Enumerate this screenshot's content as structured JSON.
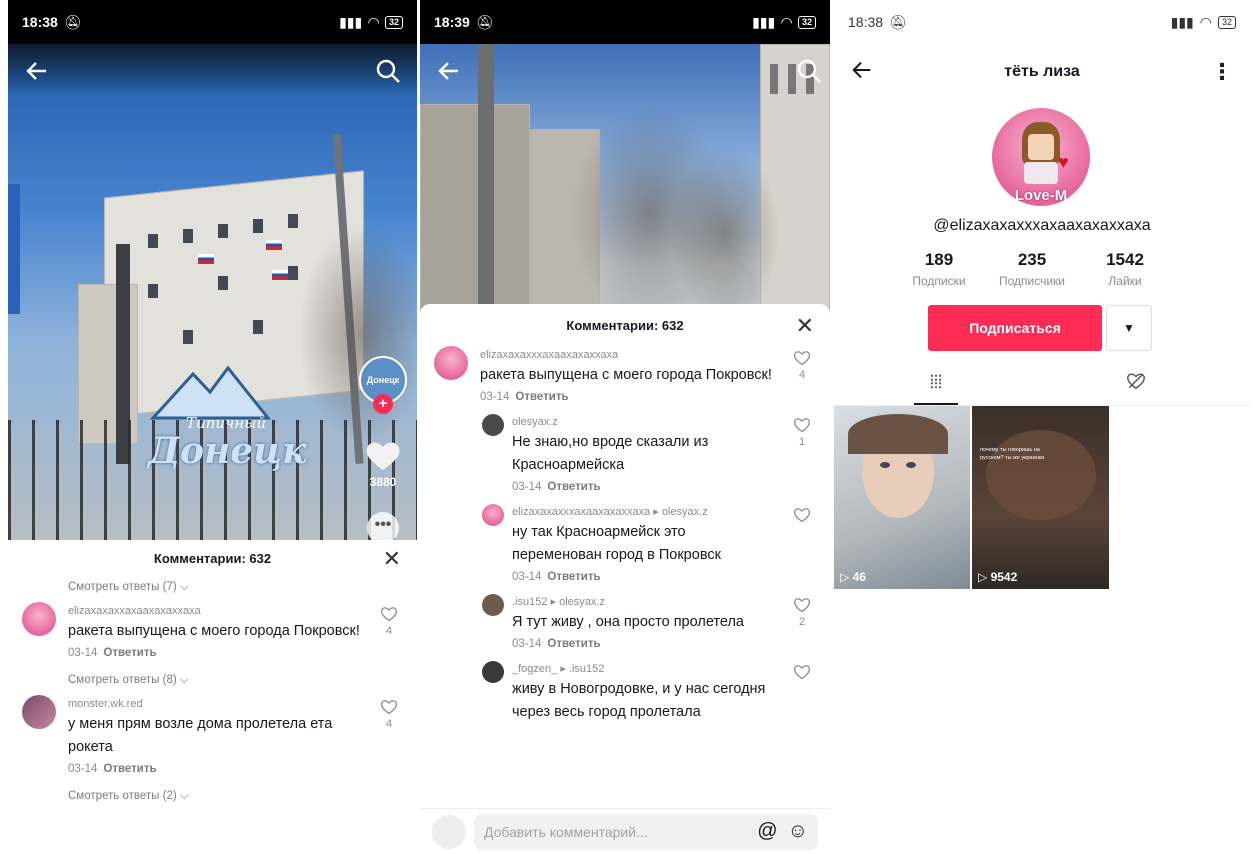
{
  "panel1": {
    "status": {
      "time": "18:38",
      "battery": "32"
    },
    "watermark": {
      "line1": "Типичный",
      "line2": "Донецк"
    },
    "like_count": "3880",
    "comments": {
      "title": "Комментарии: 632",
      "items": [
        {
          "type": "see_replies",
          "text": "Смотреть ответы (7)"
        },
        {
          "type": "comment",
          "user": "elizaxaxaxxaxaaxaxaxxaxa",
          "text": "ракета выпущена с моего города Покровск!",
          "date": "03-14",
          "reply": "Ответить",
          "likes": "4"
        },
        {
          "type": "see_replies",
          "text": "Смотреть ответы (8)"
        },
        {
          "type": "comment",
          "user": "monster.wk.red",
          "text": "у меня прям возле дома пролетела ета рокета",
          "date": "03-14",
          "reply": "Ответить",
          "likes": "4"
        },
        {
          "type": "see_replies",
          "text": "Смотреть ответы (2)"
        }
      ]
    }
  },
  "panel2": {
    "status": {
      "time": "18:39",
      "battery": "32"
    },
    "comments": {
      "title": "Комментарии: 632",
      "items": [
        {
          "reply": false,
          "user": "elizaxaxaxxxaxaaxaxaxxaxa",
          "text": "ракета выпущена с моего города Покровск!",
          "date": "03-14",
          "reply_label": "Ответить",
          "likes": "4"
        },
        {
          "reply": true,
          "user": "olesyax.z",
          "text": "Не знаю,но вроде сказали из Красноармейска",
          "date": "03-14",
          "reply_label": "Ответить",
          "likes": "1"
        },
        {
          "reply": true,
          "user": "elizaxaxaxxxaxaaxaxaxxaxa ▸ olesyax.z",
          "text": "ну так Красноармейск это переменован город в Покровск",
          "date": "03-14",
          "reply_label": "Ответить",
          "likes": ""
        },
        {
          "reply": true,
          "user": ".isu152 ▸ olesyax.z",
          "text": "Я тут живу , она просто пролетела",
          "date": "03-14",
          "reply_label": "Ответить",
          "likes": "2"
        },
        {
          "reply": true,
          "user": "_fogzen_ ▸ .isu152",
          "text": "живу в Новогродовке, и у нас сегодня через весь город пролетала",
          "date": "",
          "reply_label": "",
          "likes": ""
        }
      ]
    },
    "add_comment_placeholder": "Добавить комментарий..."
  },
  "panel3": {
    "status": {
      "time": "18:38",
      "battery": "32"
    },
    "title": "тёть лиза",
    "username": "@elizaxaxaxxxaxaaxaxaxxaxa",
    "stats": [
      {
        "value": "189",
        "label": "Подписки"
      },
      {
        "value": "235",
        "label": "Подписчики"
      },
      {
        "value": "1542",
        "label": "Лайки"
      }
    ],
    "follow_label": "Подписаться",
    "avatar_text": "Love-M",
    "thumbs": [
      {
        "views": "46"
      },
      {
        "views": "9542",
        "caption": "почему ты говоришь на русском? ты же украинка"
      }
    ]
  }
}
